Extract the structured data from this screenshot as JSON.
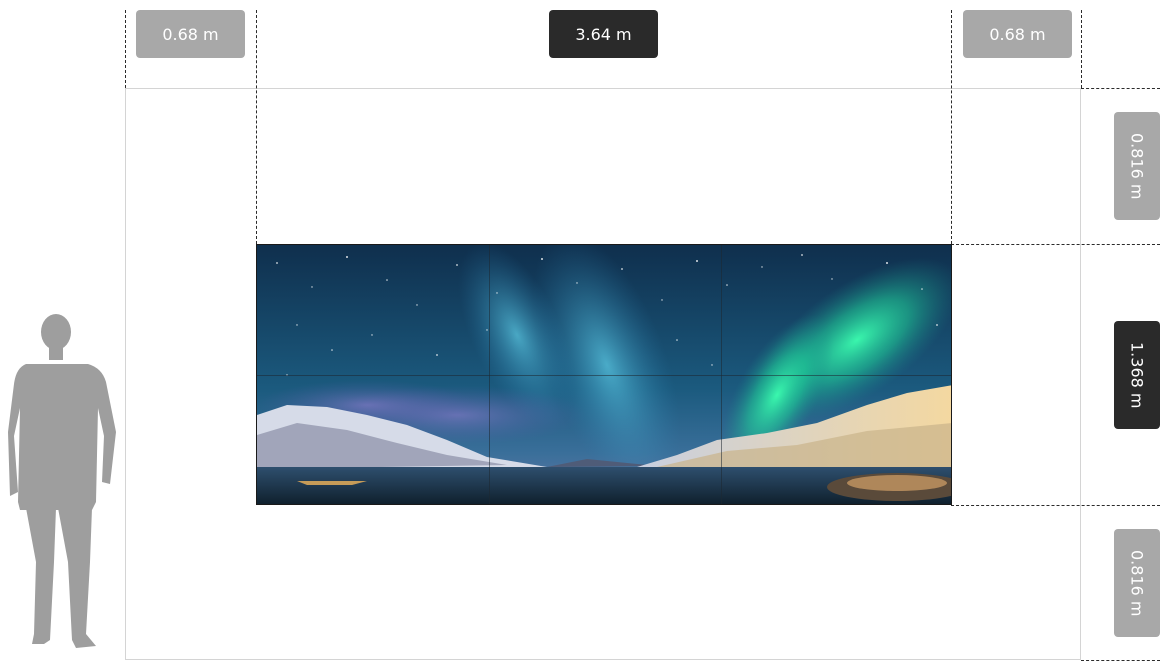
{
  "dimensions": {
    "left_margin": "0.68 m",
    "screen_width": "3.64 m",
    "right_margin": "0.68 m",
    "top_margin": "0.816 m",
    "screen_height": "1.368 m",
    "bottom_margin": "0.816 m"
  },
  "screen": {
    "columns": 3,
    "rows": 2
  },
  "colors": {
    "badge_primary": "#2a2a2a",
    "badge_secondary": "#a8a8a8",
    "human_silhouette": "#9e9e9e",
    "guide_line": "#2b2b2b"
  },
  "icons": {
    "person": "human-silhouette-icon"
  }
}
